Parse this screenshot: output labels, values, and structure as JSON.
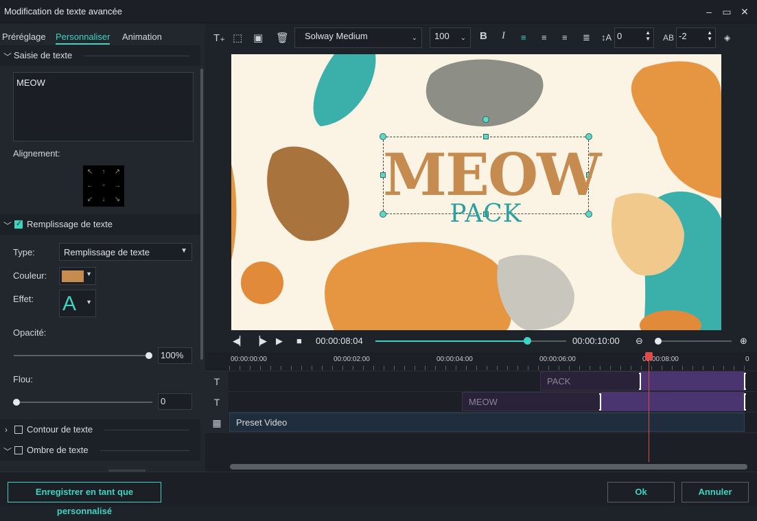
{
  "window": {
    "title": "Modification de texte avancée"
  },
  "tabs": [
    {
      "label": "Préréglage",
      "active": false
    },
    {
      "label": "Personnaliser",
      "active": true
    },
    {
      "label": "Animation",
      "active": false
    }
  ],
  "sections": {
    "text_input": {
      "title": "Saisie de texte",
      "value": "MEOW"
    },
    "alignment_label": "Alignement:",
    "fill": {
      "title": "Remplissage de texte",
      "checked": true
    },
    "type_label": "Type:",
    "type_value": "Remplissage de texte",
    "color_label": "Couleur:",
    "color_value": "#c68b4f",
    "effect_label": "Effet:",
    "effect_glyph": "A",
    "opacity_label": "Opacité:",
    "opacity_value": "100%",
    "blur_label": "Flou:",
    "blur_value": "0",
    "outline": {
      "title": "Contour de texte",
      "checked": false
    },
    "shadow": {
      "title": "Ombre de texte",
      "checked": false
    }
  },
  "toolbar": {
    "font": "Solway Medium",
    "size": "100",
    "bold": "B",
    "italic": "I",
    "line_spacing": "0",
    "letter_spacing": "-2"
  },
  "preview": {
    "title": "MEOW",
    "subtitle": "PACK",
    "title_color": "#c68b4f",
    "subtitle_color": "#2aa1a0"
  },
  "player": {
    "current_time": "00:00:08:04",
    "total_time": "00:00:10:00",
    "progress": 0.8
  },
  "timeline": {
    "ruler": [
      "00:00:00:00",
      "00:00:02:00",
      "00:00:04:00",
      "00:00:06:00",
      "00:00:08:00",
      "0"
    ],
    "tracks": [
      {
        "icon": "text-icon",
        "clip": "PACK"
      },
      {
        "icon": "text-icon",
        "clip": "MEOW"
      },
      {
        "icon": "video-icon",
        "clip": "Preset Video"
      }
    ]
  },
  "footer": {
    "save_custom": "Enregistrer en tant que personnalisé",
    "ok": "Ok",
    "cancel": "Annuler"
  }
}
